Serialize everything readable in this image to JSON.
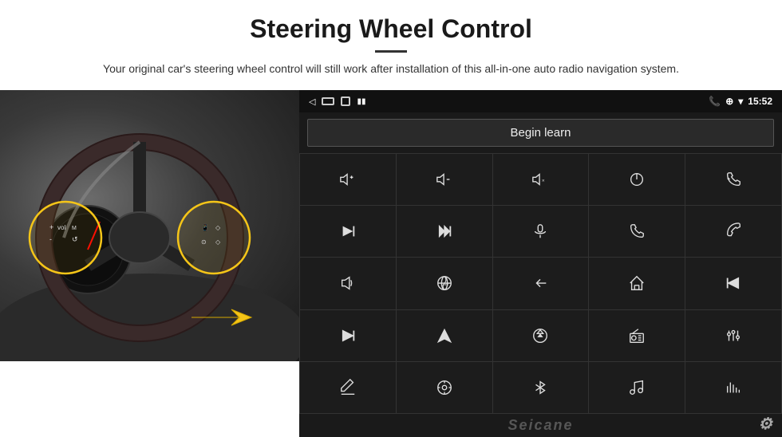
{
  "header": {
    "title": "Steering Wheel Control",
    "divider": true,
    "subtitle": "Your original car's steering wheel control will still work after installation of this all-in-one auto radio navigation system."
  },
  "statusBar": {
    "time": "15:52",
    "navBack": "◁",
    "navHome": "",
    "navRecent": ""
  },
  "beginLearnBtn": {
    "label": "Begin learn"
  },
  "watermark": {
    "text": "Seicane"
  },
  "icons": [
    {
      "id": "vol-up",
      "title": "Volume Up"
    },
    {
      "id": "vol-down",
      "title": "Volume Down"
    },
    {
      "id": "vol-mute",
      "title": "Volume Mute"
    },
    {
      "id": "power",
      "title": "Power"
    },
    {
      "id": "prev-track-call",
      "title": "Previous Track / Call"
    },
    {
      "id": "next-track",
      "title": "Next Track"
    },
    {
      "id": "fast-forward",
      "title": "Fast Forward"
    },
    {
      "id": "mic",
      "title": "Microphone"
    },
    {
      "id": "phone",
      "title": "Phone"
    },
    {
      "id": "hang-up",
      "title": "Hang Up"
    },
    {
      "id": "speaker",
      "title": "Speaker"
    },
    {
      "id": "360",
      "title": "360 View"
    },
    {
      "id": "back",
      "title": "Back"
    },
    {
      "id": "home",
      "title": "Home"
    },
    {
      "id": "rewind",
      "title": "Rewind"
    },
    {
      "id": "fast-fwd2",
      "title": "Fast Forward 2"
    },
    {
      "id": "navigation",
      "title": "Navigation"
    },
    {
      "id": "eject",
      "title": "Eject"
    },
    {
      "id": "radio",
      "title": "Radio"
    },
    {
      "id": "equalizer",
      "title": "Equalizer"
    },
    {
      "id": "pen",
      "title": "Pen"
    },
    {
      "id": "settings2",
      "title": "Settings"
    },
    {
      "id": "bluetooth",
      "title": "Bluetooth"
    },
    {
      "id": "music",
      "title": "Music"
    },
    {
      "id": "sound-bars",
      "title": "Sound Bars"
    }
  ]
}
